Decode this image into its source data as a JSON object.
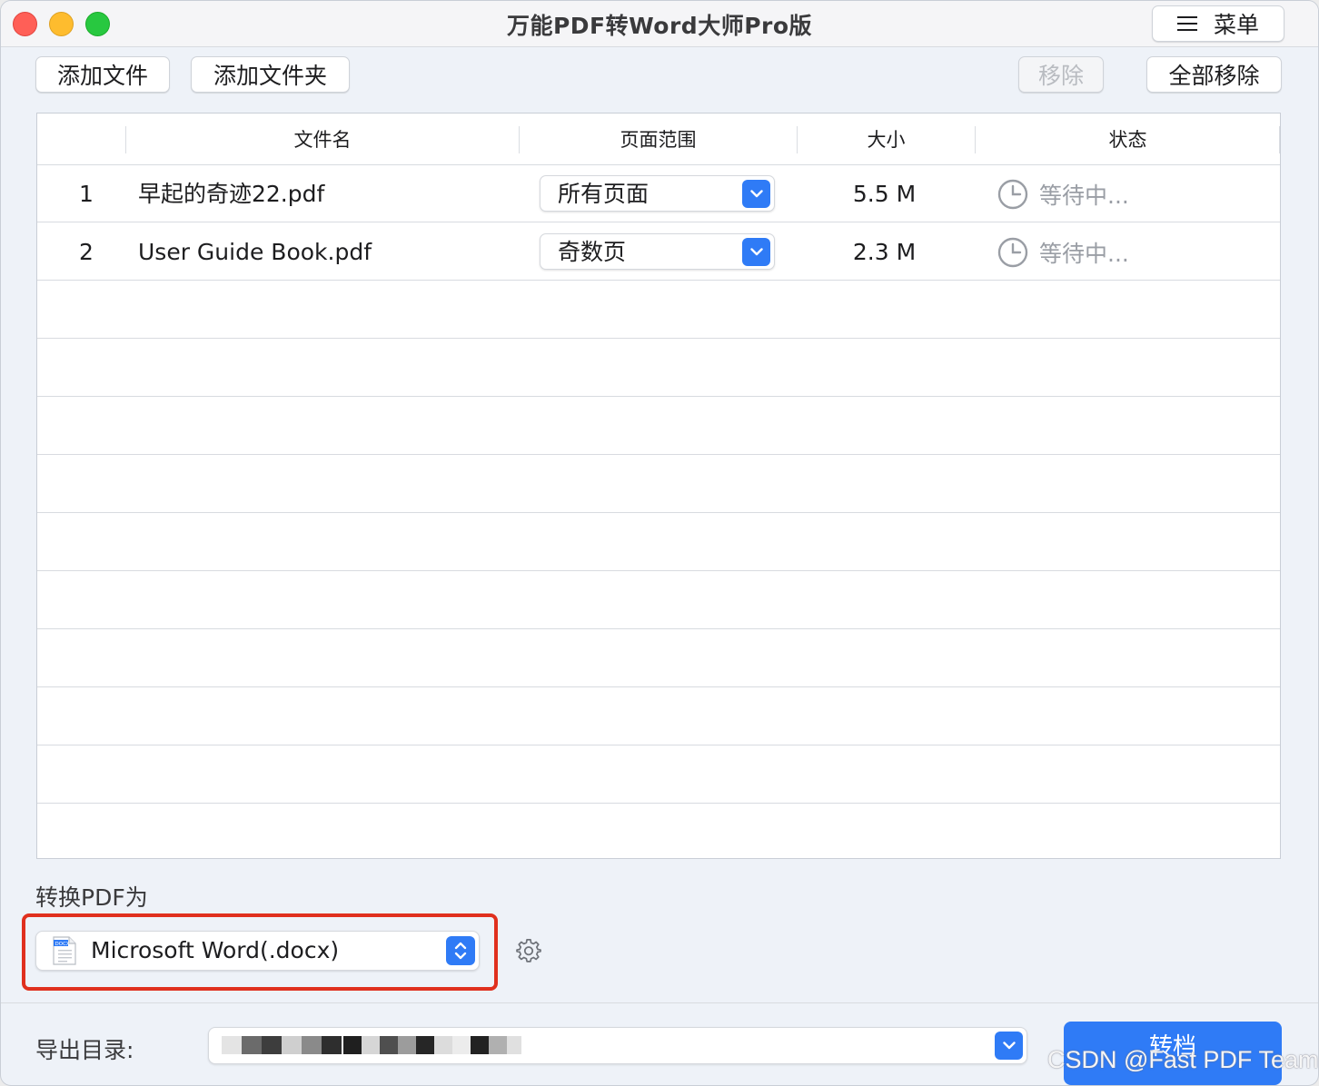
{
  "window": {
    "title": "万能PDF转Word大师Pro版",
    "menu_label": "菜单"
  },
  "toolbar": {
    "add_file": "添加文件",
    "add_folder": "添加文件夹",
    "remove": "移除",
    "remove_all": "全部移除"
  },
  "table": {
    "headers": {
      "filename": "文件名",
      "page_range": "页面范围",
      "size": "大小",
      "status": "状态"
    },
    "rows": [
      {
        "index": "1",
        "filename": "早起的奇迹22.pdf",
        "page_range": "所有页面",
        "size": "5.5 M",
        "status": "等待中..."
      },
      {
        "index": "2",
        "filename": "User Guide Book.pdf",
        "page_range": "奇数页",
        "size": "2.3 M",
        "status": "等待中..."
      }
    ]
  },
  "format": {
    "label": "转换PDF为",
    "selected": "Microsoft Word(.docx)",
    "icon_text": "DOCX"
  },
  "export": {
    "label": "导出目录:",
    "path": ""
  },
  "actions": {
    "convert": "转档"
  },
  "watermark": "CSDN @Fast PDF Team",
  "colors": {
    "accent": "#2f7bf6",
    "highlight_border": "#e0301e",
    "status_text": "#9a9ea5",
    "disabled_text": "#b9bcc1"
  },
  "icons": {
    "status": "clock-icon",
    "menu": "hamburger-icon",
    "settings": "gear-icon",
    "dropdown": "chevron-down-icon",
    "stepper": "up-down-chevron-icon",
    "file_type": "docx-file-icon"
  }
}
